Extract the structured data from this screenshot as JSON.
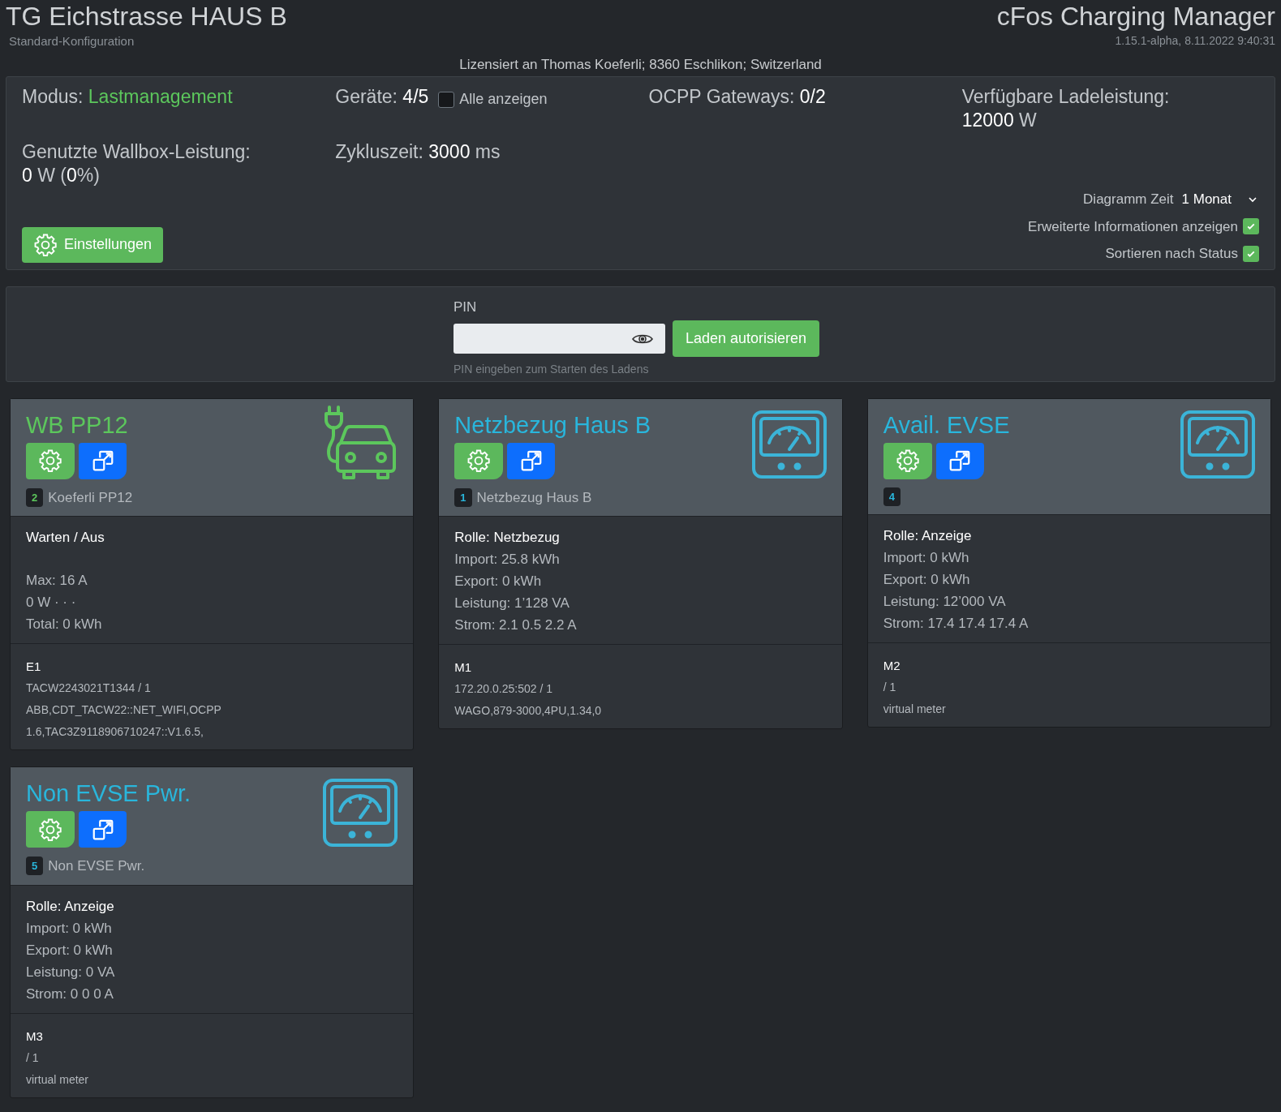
{
  "header": {
    "title": "TG Eichstrasse HAUS B",
    "subtitle": "Standard-Konfiguration",
    "app_name": "cFos Charging Manager",
    "version": "1.15.1-alpha, 8.11.2022 9:40:31",
    "license": "Lizensiert an Thomas Koeferli; 8360 Eschlikon; Switzerland"
  },
  "status": {
    "stats": [
      {
        "parts": [
          {
            "kind": "label",
            "text": "Modus: "
          },
          {
            "kind": "accent",
            "text": "Lastmanagement"
          }
        ]
      },
      {
        "parts": [
          {
            "kind": "label",
            "text": "Geräte: "
          },
          {
            "kind": "value",
            "text": "4/5"
          }
        ],
        "checkbox": {
          "label": "Alle anzeigen",
          "checked": false
        }
      },
      {
        "parts": [
          {
            "kind": "label",
            "text": "OCPP Gateways: "
          },
          {
            "kind": "value",
            "text": "0/2"
          }
        ]
      },
      {
        "parts": [
          {
            "kind": "label",
            "text": "Verfügbare Ladeleistung: "
          },
          {
            "kind": "value",
            "text": "12000"
          },
          {
            "kind": "label",
            "text": " W"
          }
        ]
      },
      {
        "parts": [
          {
            "kind": "label",
            "text": "Genutzte Wallbox-Leistung: "
          },
          {
            "kind": "value",
            "text": "0"
          },
          {
            "kind": "label",
            "text": " W ("
          },
          {
            "kind": "value",
            "text": "0"
          },
          {
            "kind": "label",
            "text": "%)"
          }
        ]
      },
      {
        "parts": [
          {
            "kind": "label",
            "text": "Zykluszeit: "
          },
          {
            "kind": "value",
            "text": "3000"
          },
          {
            "kind": "label",
            "text": " ms"
          }
        ]
      }
    ],
    "settings_button": "Einstellungen",
    "chart_time": {
      "label": "Diagramm Zeit",
      "value": "1 Monat"
    },
    "options": [
      {
        "label": "Erweiterte Informationen anzeigen",
        "checked": true
      },
      {
        "label": "Sortieren nach Status",
        "checked": true
      }
    ]
  },
  "pin": {
    "label": "PIN",
    "help": "PIN eingeben zum Starten des Ladens",
    "button": "Laden autorisieren"
  },
  "devices": [
    {
      "kind": "wallbox",
      "title": "WB PP12",
      "badge": "2",
      "name": "Koeferli PP12",
      "status": [
        "Warten / Aus",
        "Max: 16 A",
        "0 W · · ·",
        "Total: 0 kWh"
      ],
      "info_id": "E1",
      "info": [
        "TACW2243021T1344 / 1",
        "ABB,CDT_TACW22::NET_WIFI,OCPP 1.6,TAC3Z9118906710247::V1.6.5,"
      ]
    },
    {
      "kind": "meter",
      "title": "Netzbezug Haus B",
      "badge": "1",
      "name": "Netzbezug Haus B",
      "status": [
        "Rolle: Netzbezug",
        "Import: 25.8 kWh",
        "Export: 0 kWh",
        "Leistung: 1’128 VA",
        "Strom: 2.1 0.5 2.2 A"
      ],
      "info_id": "M1",
      "info": [
        "172.20.0.25:502 / 1",
        "WAGO,879-3000,4PU,1.34,0"
      ]
    },
    {
      "kind": "meter",
      "title": "Avail. EVSE",
      "badge": "4",
      "status": [
        "Rolle: Anzeige",
        "Import: 0 kWh",
        "Export: 0 kWh",
        "Leistung: 12’000 VA",
        "Strom: 17.4 17.4 17.4 A"
      ],
      "info_id": "M2",
      "info": [
        "/ 1",
        "virtual meter"
      ]
    },
    {
      "kind": "meter",
      "title": "Non EVSE Pwr.",
      "badge": "5",
      "name": "Non EVSE Pwr.",
      "status": [
        "Rolle: Anzeige",
        "Import: 0 kWh",
        "Export: 0 kWh",
        "Leistung: 0 VA",
        "Strom: 0 0 0 A"
      ],
      "info_id": "M3",
      "info": [
        "/ 1",
        "virtual meter"
      ]
    }
  ]
}
